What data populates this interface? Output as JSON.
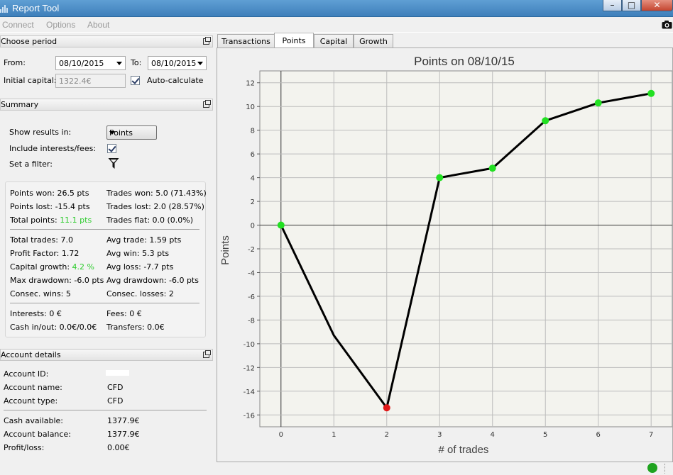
{
  "window": {
    "title": "Report Tool"
  },
  "menu": {
    "connect": "Connect",
    "options": "Options",
    "about": "About"
  },
  "choose_period": {
    "header": "Choose period",
    "from_label": "From:",
    "from_value": "08/10/2015",
    "to_label": "To:",
    "to_value": "08/10/2015",
    "initial_capital_label": "Initial capital:",
    "initial_capital_value": "1322.4€",
    "auto_calculate_label": "Auto-calculate"
  },
  "summary": {
    "header": "Summary",
    "show_results_label": "Show results in:",
    "show_results_value": "Points",
    "include_interests_label": "Include interests/fees:",
    "set_filter_label": "Set a filter:",
    "points_won": "Points won: 26.5 pts",
    "trades_won": "Trades won: 5.0 (71.43%)",
    "points_lost": "Points lost: -15.4 pts",
    "trades_lost": "Trades lost: 2.0 (28.57%)",
    "total_points_label": "Total points:",
    "total_points_value": "11.1 pts",
    "trades_flat": "Trades flat: 0.0 (0.0%)",
    "total_trades": "Total trades: 7.0",
    "avg_trade": "Avg trade: 1.59 pts",
    "profit_factor": "Profit Factor: 1.72",
    "avg_win": "Avg win: 5.3 pts",
    "capital_growth_label": "Capital growth:",
    "capital_growth_value": "4.2 %",
    "avg_loss": "Avg loss: -7.7 pts",
    "max_drawdown": "Max drawdown: -6.0 pts",
    "avg_drawdown": "Avg drawdown: -6.0 pts",
    "consec_wins": "Consec. wins: 5",
    "consec_losses": "Consec. losses: 2",
    "interests": "Interests: 0 €",
    "fees": "Fees: 0 €",
    "cash_in_out": "Cash in/out: 0.0€/0.0€",
    "transfers": "Transfers: 0.0€"
  },
  "account": {
    "header": "Account details",
    "id_label": "Account ID:",
    "name_label": "Account name:",
    "name_value": "CFD",
    "type_label": "Account type:",
    "type_value": "CFD",
    "cash_label": "Cash available:",
    "cash_value": "1377.9€",
    "balance_label": "Account balance:",
    "balance_value": "1377.9€",
    "pl_label": "Profit/loss:",
    "pl_value": "0.00€"
  },
  "tabs": [
    "Transactions",
    "Points",
    "Capital",
    "Growth"
  ],
  "active_tab": "Points",
  "colors": {
    "positive": "#2ecc2e",
    "win_point": "#22e022",
    "loss_point": "#e01818",
    "status_ok": "#1fa31f"
  },
  "chart_data": {
    "type": "line",
    "title": "Points on 08/10/15",
    "xlabel": "# of trades",
    "ylabel": "Points",
    "x": [
      0,
      1,
      2,
      3,
      4,
      5,
      6,
      7
    ],
    "y": [
      0,
      -9.3,
      -15.4,
      4.0,
      4.8,
      8.8,
      10.3,
      11.1
    ],
    "markers": [
      "win",
      "none",
      "loss",
      "win",
      "win",
      "win",
      "win",
      "win"
    ],
    "xlim": [
      -0.4,
      7.4
    ],
    "ylim": [
      -17,
      13
    ],
    "xticks": [
      "0",
      "1",
      "2",
      "3",
      "4",
      "5",
      "6",
      "7"
    ],
    "yticks": [
      "12",
      "10",
      "8",
      "6",
      "4",
      "2",
      "0",
      "-2",
      "-4",
      "-6",
      "-8",
      "-10",
      "-12",
      "-14",
      "-16"
    ],
    "grid": true
  }
}
